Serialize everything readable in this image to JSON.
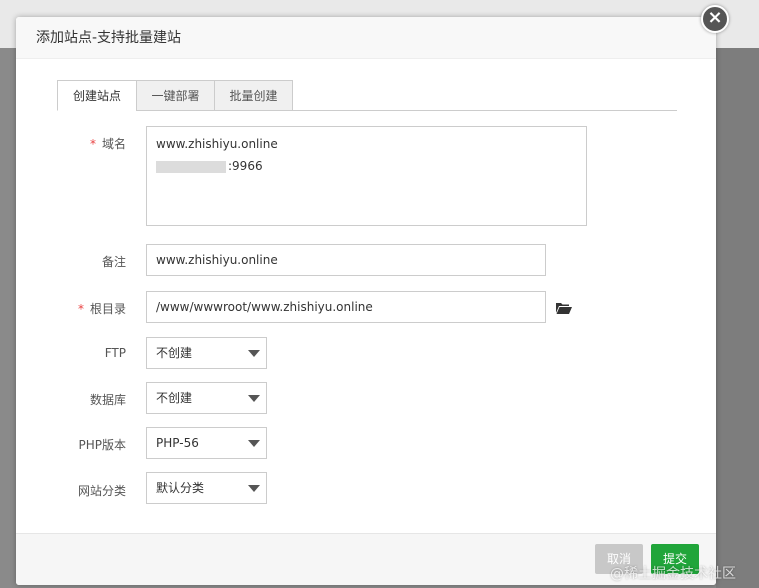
{
  "dialog": {
    "title": "添加站点-支持批量建站"
  },
  "tabs": [
    {
      "label": "创建站点"
    },
    {
      "label": "一键部署"
    },
    {
      "label": "批量创建"
    }
  ],
  "form": {
    "required_mark": "*",
    "domain": {
      "label": "域名",
      "line1": "www.zhishiyu.online",
      "line2_suffix": ":9966"
    },
    "remark": {
      "label": "备注",
      "value": "www.zhishiyu.online"
    },
    "root_dir": {
      "label": "根目录",
      "value": "/www/wwwroot/www.zhishiyu.online"
    },
    "ftp": {
      "label": "FTP",
      "selected": "不创建"
    },
    "database": {
      "label": "数据库",
      "selected": "不创建"
    },
    "php_version": {
      "label": "PHP版本",
      "selected": "PHP-56"
    },
    "site_category": {
      "label": "网站分类",
      "selected": "默认分类"
    }
  },
  "footer": {
    "cancel_label": "取消",
    "submit_label": "提交"
  },
  "watermark": "@稀土掘金技术社区",
  "colors": {
    "accent_green": "#20a53a",
    "required_red": "#e94343",
    "cancel_gray": "#c8c8c8"
  }
}
